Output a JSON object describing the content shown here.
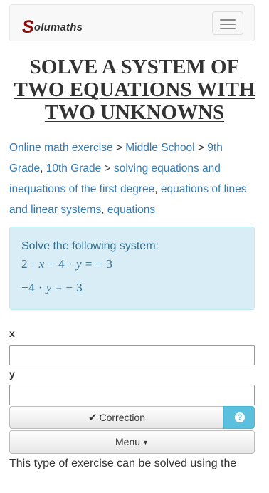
{
  "navbar": {
    "brand_initial": "S",
    "brand_rest": "olumaths",
    "toggle_icon": "hamburger-icon"
  },
  "page_title": {
    "line1": "SOLVE A SYSTEM OF",
    "line2": "TWO EQUATIONS WITH",
    "line3": "TWO UNKNOWNS"
  },
  "breadcrumb": {
    "link1": "Online math exercise",
    "sep1": " > ",
    "link2": "Middle School",
    "sep2": " > ",
    "link3": "9th Grade",
    "sep3": ", ",
    "link4": "10th Grade",
    "sep4": " > ",
    "link5": "solving equations and inequations of the first degree",
    "sep5": ", ",
    "link6": "equations of lines and linear systems",
    "sep6": ", ",
    "link7": "equations"
  },
  "exercise": {
    "prompt": "Solve the following system:",
    "eq1": {
      "a": "2",
      "dot1": " · ",
      "x": "x",
      "op": " − 4 · ",
      "y": "y",
      "rhs": " =  − 3"
    },
    "eq2": {
      "a": "−4 · ",
      "y": "y",
      "rhs": " =  − 3"
    }
  },
  "answers": {
    "x_label": "x",
    "x_value": "",
    "y_label": "y",
    "y_value": ""
  },
  "buttons": {
    "check_icon": "checkmark-icon",
    "correction_label": "Correction",
    "help_icon": "question-icon",
    "help_glyph": "?",
    "menu_label": "Menu",
    "menu_caret": "▼"
  },
  "footer_text": "This type of exercise can be solved using the",
  "colors": {
    "link": "#337ab7",
    "brand": "#8b0a0a",
    "alert_bg": "#d9edf7",
    "alert_text": "#31708f",
    "help_button": "#5bc0de"
  }
}
